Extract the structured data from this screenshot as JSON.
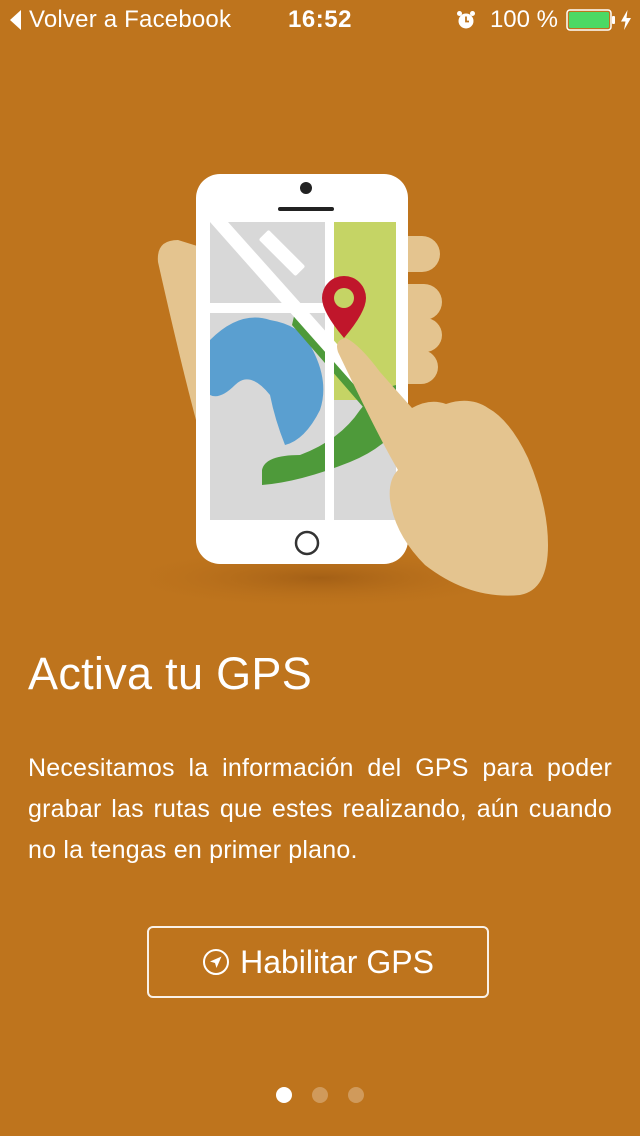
{
  "status_bar": {
    "back_label": "Volver a Facebook",
    "time": "16:52",
    "battery_percent": "100 %",
    "battery_level": 1.0,
    "icons": [
      "back-chevron-icon",
      "alarm-icon",
      "battery-icon",
      "charging-bolt-icon"
    ]
  },
  "onboarding": {
    "title": "Activa tu GPS",
    "description": "Necesitamos la información del GPS para poder grabar las rutas que estes realizando, aún cuando no la tengas en primer plano.",
    "button_label": "Habilitar GPS",
    "button_icon": "navigation-arrow-icon"
  },
  "pager": {
    "total_pages": 3,
    "current_page": 1
  },
  "colors": {
    "background": "#BE741D",
    "text": "#FFFFFF",
    "battery_fill": "#4CD964",
    "map_pin": "#C0162B",
    "map_water": "#5A9FD0",
    "map_park": "#4E9A3A",
    "map_block": "#C5D465",
    "hand": "#E4C48F"
  }
}
